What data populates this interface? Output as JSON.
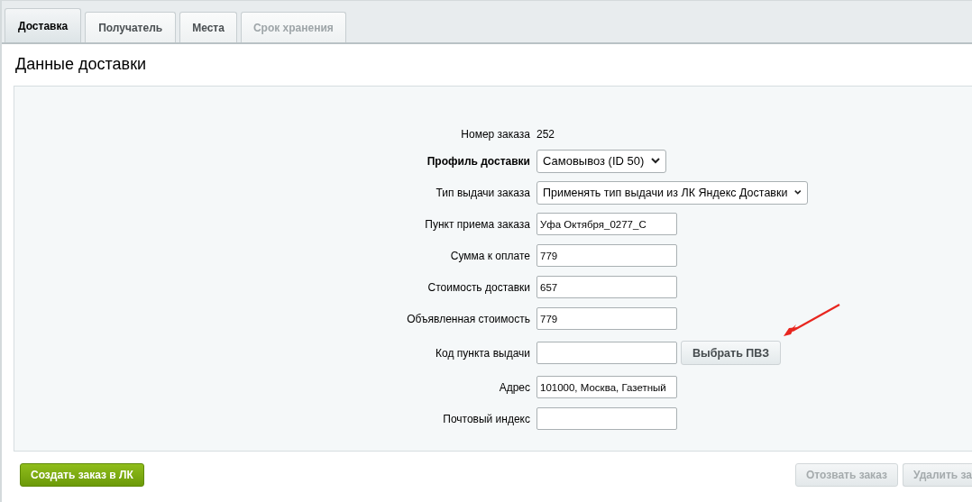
{
  "tabs": [
    {
      "label": "Доставка",
      "selected": true,
      "disabled": false
    },
    {
      "label": "Получатель",
      "selected": false,
      "disabled": false
    },
    {
      "label": "Места",
      "selected": false,
      "disabled": false
    },
    {
      "label": "Срок хранения",
      "selected": false,
      "disabled": true
    }
  ],
  "title": "Данные доставки",
  "form": [
    {
      "kind": "text",
      "label": "Номер заказа",
      "bold": false,
      "value": "252"
    },
    {
      "kind": "select",
      "label": "Профиль доставки",
      "bold": true,
      "value": "Самовывоз (ID 50)",
      "wide": false
    },
    {
      "kind": "select",
      "label": "Тип выдачи заказа",
      "bold": false,
      "value": "Применять тип выдачи из ЛК Яндекс Доставки",
      "wide": true
    },
    {
      "kind": "input",
      "label": "Пункт приема заказа",
      "bold": false,
      "value": "Уфа Октября_0277_С"
    },
    {
      "kind": "input",
      "label": "Сумма к оплате",
      "bold": false,
      "value": "779"
    },
    {
      "kind": "input",
      "label": "Стоимость доставки",
      "bold": false,
      "value": "657"
    },
    {
      "kind": "input",
      "label": "Объявленная стоимость",
      "bold": false,
      "value": "779"
    },
    {
      "kind": "input_button",
      "label": "Код пункта выдачи",
      "bold": false,
      "button": "Выбрать ПВЗ"
    },
    {
      "kind": "input",
      "label": "Адрес",
      "bold": false,
      "value": "101000, Москва, Газетный"
    },
    {
      "kind": "input",
      "label": "Почтовый индекс",
      "bold": false
    }
  ],
  "actions": [
    {
      "label": "Создать заказ в ЛК",
      "kind": "primary",
      "disabled": false
    },
    {
      "label": "Отозвать заказ",
      "kind": "secondary",
      "disabled": true
    },
    {
      "label": "Удалить за",
      "kind": "secondary",
      "disabled": true
    }
  ]
}
